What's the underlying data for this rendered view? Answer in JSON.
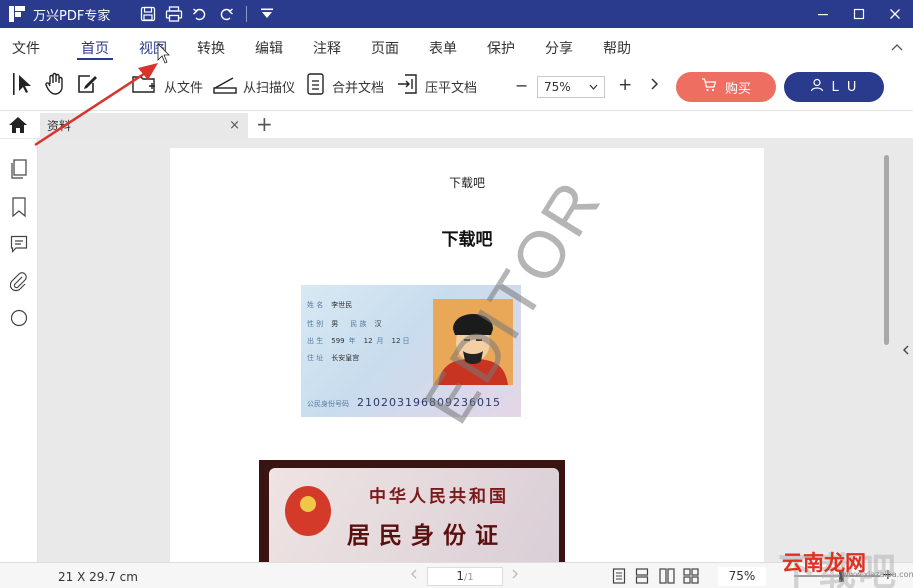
{
  "app": {
    "title": "万兴PDF专家"
  },
  "menu": {
    "items": [
      {
        "label": "文件"
      },
      {
        "label": "首页"
      },
      {
        "label": "视图"
      },
      {
        "label": "转换"
      },
      {
        "label": "编辑"
      },
      {
        "label": "注释"
      },
      {
        "label": "页面"
      },
      {
        "label": "表单"
      },
      {
        "label": "保护"
      },
      {
        "label": "分享"
      },
      {
        "label": "帮助"
      }
    ],
    "active": "首页",
    "hover": "视图"
  },
  "toolbar": {
    "from_file": "从文件",
    "from_scanner": "从扫描仪",
    "merge": "合并文档",
    "flatten": "压平文档",
    "zoom": "75%",
    "zoom_minus": "−",
    "zoom_plus": "+",
    "buy": "购买",
    "user": "L U"
  },
  "tabs": {
    "doc_name": "资料",
    "close": "×",
    "add": "+"
  },
  "page": {
    "header": "下载吧",
    "title": "下载吧",
    "watermark": "EDITOR"
  },
  "idcard_front": {
    "name_label": "姓 名",
    "name_value": "李世民",
    "sex_label": "性 别",
    "sex_value": "男",
    "nation_label": "民 族",
    "nation_value": "汉",
    "birth_label": "出 生",
    "birth_year": "599",
    "birth_month_label": "年",
    "birth_month": "12",
    "birth_day_label": "月",
    "birth_day": "12",
    "birth_day_suffix": "日",
    "address_label": "住 址",
    "address_value": "长安皇宫",
    "id_label": "公民身份号码",
    "id_value": "210203196809236015"
  },
  "idcard_back": {
    "line1": "中华人民共和国",
    "line2": "居民身份证"
  },
  "status": {
    "page_size": "21 X 29.7 cm",
    "page_current": "1",
    "page_total": "/1",
    "zoom": "75%",
    "zoom_plus": "+"
  },
  "site_mark": {
    "big": "下载吧",
    "small": "云南龙网",
    "url": "www.xiazaiba.com"
  },
  "colors": {
    "brand": "#2a3a8c",
    "buy": "#ee6e62",
    "annotation": "#d9332b"
  }
}
